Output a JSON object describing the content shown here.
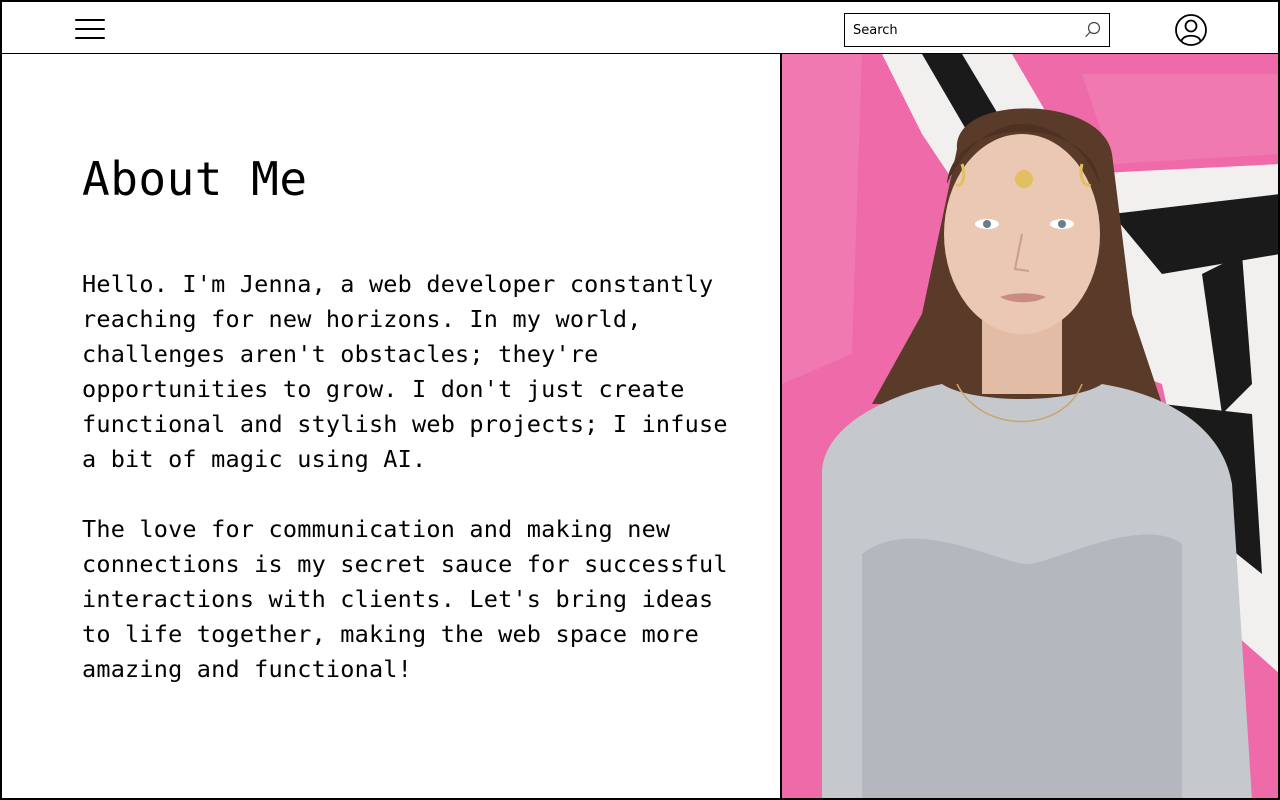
{
  "header": {
    "menu_icon": "hamburger-menu-icon",
    "search": {
      "placeholder": "Search",
      "value": "",
      "icon": "search-icon"
    },
    "profile_icon": "user-circle-icon"
  },
  "about": {
    "title": "About Me",
    "paragraphs": [
      "Hello. I'm Jenna, a web developer constantly reaching for new horizons. In my world, challenges aren't obstacles; they're opportunities to grow. I don't just create functional and stylish web projects; I infuse a bit of magic using AI.",
      "The love for communication and making new connections is my secret sauce for successful interactions with clients. Let's bring ideas to life together, making the web space more amazing and functional!"
    ]
  },
  "photo": {
    "subject": "portrait of Jenna in front of pink graffiti wall",
    "colors": {
      "wall_pink": "#ee6aa8",
      "wall_white": "#f1f0ee",
      "graffiti_black": "#1a1a1a",
      "top_gray": "#b8bcc2",
      "hair": "#5a3a28",
      "skin": "#e9c6b2"
    }
  },
  "colors": {
    "border": "#000000",
    "background": "#ffffff",
    "text": "#000000"
  }
}
